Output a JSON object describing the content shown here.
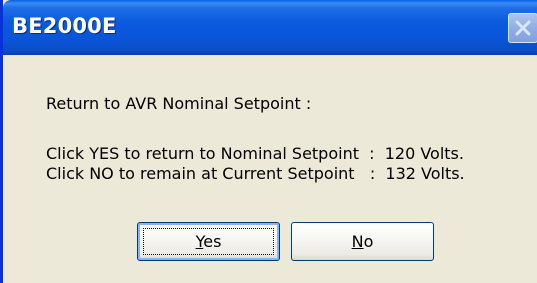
{
  "window": {
    "title": "BE2000E",
    "close_icon": "close-icon"
  },
  "message": {
    "heading": "Return to AVR Nominal Setpoint :",
    "yes_line": "Click YES to return to Nominal Setpoint  :  120 Volts.",
    "no_line": "Click NO to remain at Current Setpoint   :  132 Volts."
  },
  "buttons": {
    "yes": {
      "mnemonic": "Y",
      "rest": "es"
    },
    "no": {
      "mnemonic": "N",
      "rest": "o"
    }
  },
  "colors": {
    "titlebar": "#0a55d8",
    "dialog_face": "#ece9d8",
    "button_border": "#003c74"
  }
}
